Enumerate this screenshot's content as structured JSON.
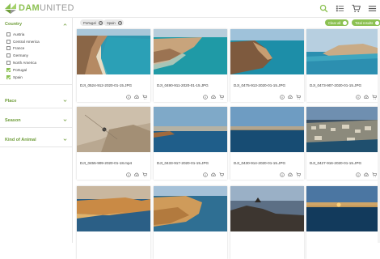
{
  "app": {
    "logo_text_1": "DAM",
    "logo_text_2": "UNITED",
    "accent": "#8cc152",
    "header_icons": [
      "search-icon",
      "list-view-icon",
      "cart-icon",
      "menu-icon"
    ]
  },
  "sidebar": {
    "sections": [
      {
        "title": "Country",
        "expanded": true,
        "options": [
          {
            "label": "Austria",
            "checked": false
          },
          {
            "label": "Central America",
            "checked": false
          },
          {
            "label": "France",
            "checked": false
          },
          {
            "label": "Germany",
            "checked": false
          },
          {
            "label": "North America",
            "checked": false
          },
          {
            "label": "Portugal",
            "checked": true
          },
          {
            "label": "Spain",
            "checked": true
          }
        ]
      },
      {
        "title": "Place",
        "expanded": false
      },
      {
        "title": "Season",
        "expanded": false
      },
      {
        "title": "Kind of Animal",
        "expanded": false
      }
    ]
  },
  "filters": {
    "chips": [
      "Portugal",
      "Spain"
    ],
    "clear_all": "Clear all",
    "total_results": "Total results"
  },
  "assets": [
    {
      "name": "DJI_0524-912-2020-01-15.JPG",
      "scene": "cliff-beach"
    },
    {
      "name": "DJI_0490-911-2020-01-15.JPG",
      "scene": "cliff-sea"
    },
    {
      "name": "DJI_0475-913-2020-01-15.JPG",
      "scene": "cliff-sea2"
    },
    {
      "name": "DJI_0473-907-2020-01-15.JPG",
      "scene": "coast-wide"
    },
    {
      "name": "DJI_0455-909-2020-01-18.mp4",
      "scene": "sand-top"
    },
    {
      "name": "DJI_0433-917-2020-01-15.JPG",
      "scene": "sea-sunset"
    },
    {
      "name": "DJI_0430-914-2020-01-15.JPG",
      "scene": "horizon"
    },
    {
      "name": "DJI_0427-916-2020-01-15.JPG",
      "scene": "town"
    },
    {
      "name": "",
      "scene": "cliff-sunset"
    },
    {
      "name": "",
      "scene": "cliff-golden"
    },
    {
      "name": "",
      "scene": "rock-dusk"
    },
    {
      "name": "",
      "scene": "sunset-sea"
    }
  ],
  "card_actions": [
    "info-icon",
    "download-icon",
    "add-to-cart-icon"
  ]
}
